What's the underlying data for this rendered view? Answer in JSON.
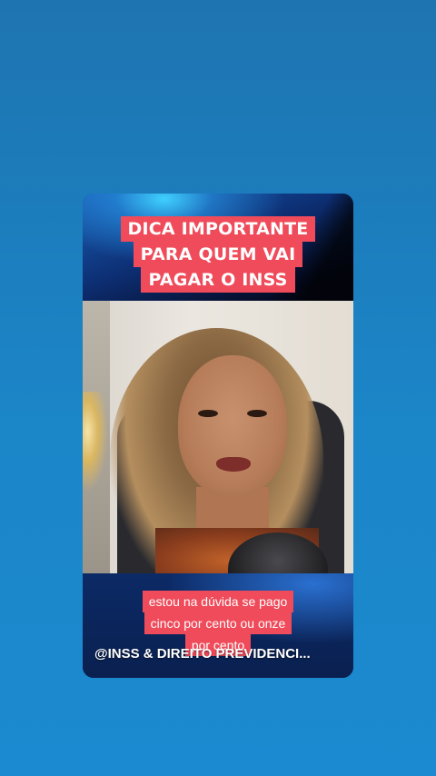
{
  "headline": {
    "lines": [
      "DICA IMPORTANTE",
      "PARA QUEM VAI",
      "PAGAR O INSS"
    ]
  },
  "caption": {
    "lines": [
      "estou na dúvida se pago",
      "cinco por cento ou onze",
      "por cento"
    ]
  },
  "channel": {
    "handle": "@INSS & DIREITO PREVIDENCI..."
  },
  "colors": {
    "background": "#1b86c8",
    "label_red": "#ef4b5a",
    "banner_navy": "#0c2a66"
  }
}
